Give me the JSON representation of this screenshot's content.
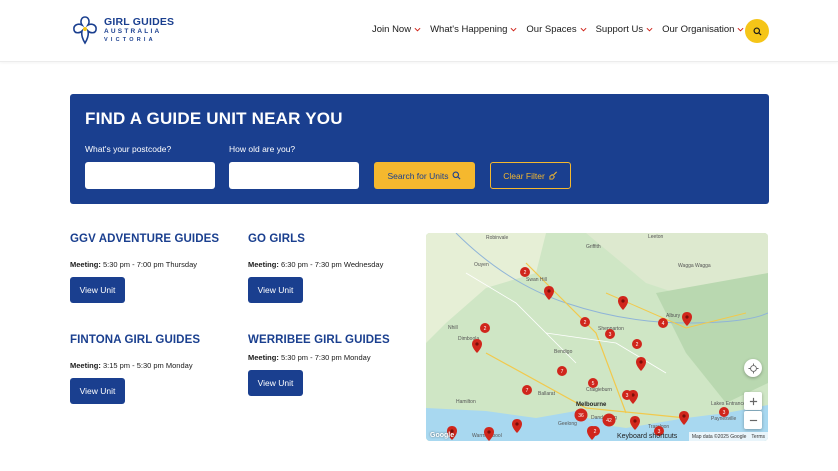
{
  "brand": {
    "line1": "GIRL GUIDES",
    "line2": "AUSTRALIA",
    "line3": "VICTORIA",
    "color_primary": "#1a3f8f",
    "color_accent": "#f5c518"
  },
  "nav": {
    "items": [
      {
        "label": "Join Now"
      },
      {
        "label": "What's Happening"
      },
      {
        "label": "Our Spaces"
      },
      {
        "label": "Support Us"
      },
      {
        "label": "Our Organisation"
      }
    ],
    "search_icon": "search-icon"
  },
  "finder": {
    "title": "FIND A GUIDE UNIT NEAR YOU",
    "postcode_label": "What's your postcode?",
    "postcode_value": "",
    "age_label": "How old are you?",
    "age_value": "",
    "search_label": "Search for Units",
    "clear_label": "Clear Filter"
  },
  "units": [
    {
      "name": "GGV ADVENTURE GUIDES",
      "meeting_label": "Meeting:",
      "meeting_time": "5:30 pm - 7:00 pm Thursday",
      "button": "View Unit"
    },
    {
      "name": "GO GIRLS",
      "meeting_label": "Meeting:",
      "meeting_time": "6:30 pm - 7:30 pm Wednesday",
      "button": "View Unit"
    },
    {
      "name": "FINTONA GIRL GUIDES",
      "meeting_label": "Meeting:",
      "meeting_time": "3:15 pm - 5:30 pm Monday",
      "button": "View Unit"
    },
    {
      "name": "WERRIBEE GIRL GUIDES",
      "meeting_label": "Meeting:",
      "meeting_time": "5:30 pm - 7:30 pm Monday",
      "button": "View Unit"
    }
  ],
  "map": {
    "places": [
      "Robinvale",
      "Leeton",
      "Ouyen",
      "Swan Hill",
      "Wagga Wagga",
      "Albury",
      "Shepparton",
      "Bendigo",
      "Nhill",
      "Dimboola",
      "Ballarat",
      "Melbourne",
      "Hamilton",
      "Warrnambool",
      "Geelong",
      "Dandenong",
      "Lakes Entrance",
      "Traralgon",
      "Paynesville",
      "Craigieburn",
      "Griffith"
    ],
    "cluster_labels": [
      "2",
      "2",
      "2",
      "3",
      "3",
      "4",
      "7",
      "7",
      "5",
      "3",
      "2",
      "36",
      "42",
      "3",
      "3",
      "2"
    ],
    "keyboard_shortcuts": "Keyboard shortcuts",
    "attribution": "Map data ©2025 Google",
    "terms": "Terms",
    "google": "Google"
  }
}
